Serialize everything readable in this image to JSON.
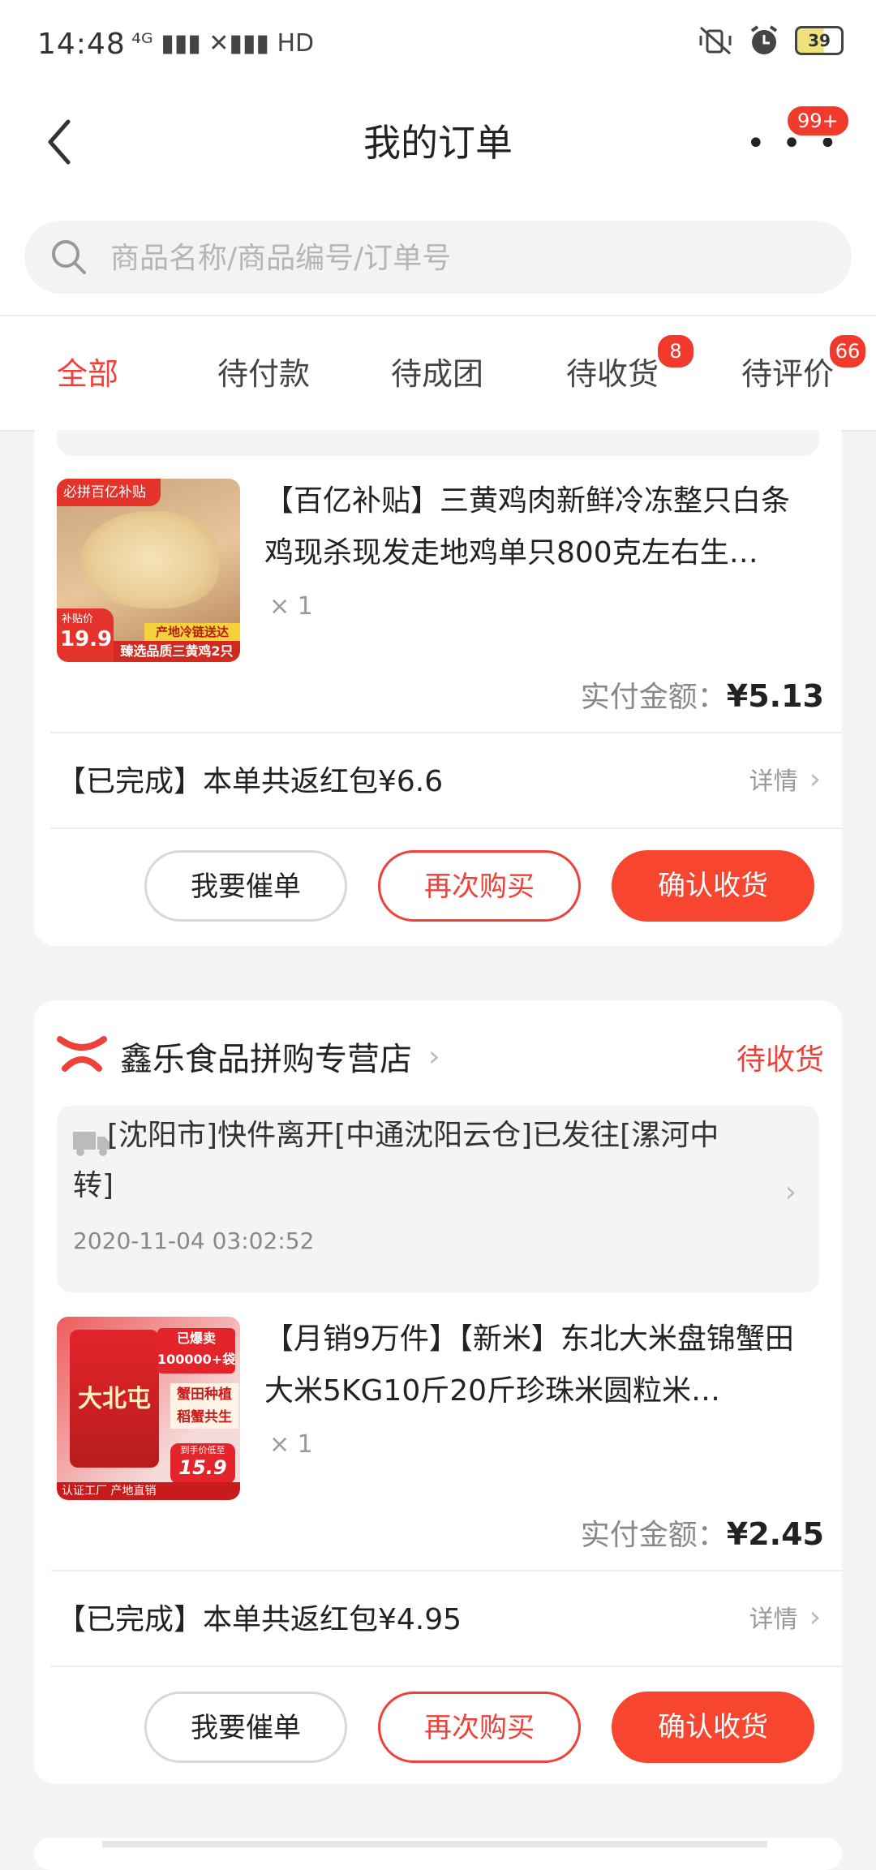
{
  "status_bar": {
    "time": "14:48",
    "network": "⁴ᴳ ▮▮▮ ✕▮▮▮ HD",
    "battery": "39",
    "icons": [
      "mute-vibrate-icon",
      "alarm-icon",
      "battery-icon"
    ]
  },
  "header": {
    "title": "我的订单",
    "more_badge": "99+",
    "search_placeholder": "商品名称/商品编号/订单号"
  },
  "tabs": [
    {
      "label": "全部",
      "active": true
    },
    {
      "label": "待付款"
    },
    {
      "label": "待成团"
    },
    {
      "label": "待收货",
      "badge": "8"
    },
    {
      "label": "待评价",
      "badge": "66"
    }
  ],
  "orders": [
    {
      "product_title": "【百亿补贴】三黄鸡肉新鲜冷冻整只白条鸡现杀现发走地鸡单只800克左右生…",
      "thumb": {
        "top_tag": "必拼百亿补贴",
        "price_tag": "19.9",
        "price_label": "补贴价",
        "banner1": "产地冷链送达",
        "banner2": "臻选品质三黄鸡2只"
      },
      "quantity": "× 1",
      "pay_label": "实付金额：",
      "pay_amount": "¥5.13",
      "status_note": "【已完成】本单共返红包¥6.6",
      "detail": "详情",
      "buttons": {
        "urge": "我要催单",
        "rebuy": "再次购买",
        "confirm": "确认收货"
      }
    },
    {
      "shop_name": "鑫乐食品拼购专营店",
      "shop_status": "待收货",
      "logistics_text": "[沈阳市]快件离开[中通沈阳云仓]已发往[漯河中转]",
      "logistics_time": "2020-11-04 03:02:52",
      "product_title": "【月销9万件】【新米】东北大米盘锦蟹田大米5KG10斤20斤珍珠米圆粒米…",
      "thumb": {
        "badge": "已爆卖 100000+袋",
        "side1": "蟹田种植",
        "side2": "稻蟹共生",
        "bag_text": "大北屯",
        "footer": "认证工厂 产地直销",
        "price": "15.9",
        "price_label": "到手价低至"
      },
      "quantity": "× 1",
      "pay_label": "实付金额：",
      "pay_amount": "¥2.45",
      "status_note": "【已完成】本单共返红包¥4.95",
      "detail": "详情",
      "buttons": {
        "urge": "我要催单",
        "rebuy": "再次购买",
        "confirm": "确认收货"
      }
    }
  ],
  "colors": {
    "accent": "#f0403a",
    "button_fill": "#f7452f",
    "background": "#f4f4f4"
  }
}
